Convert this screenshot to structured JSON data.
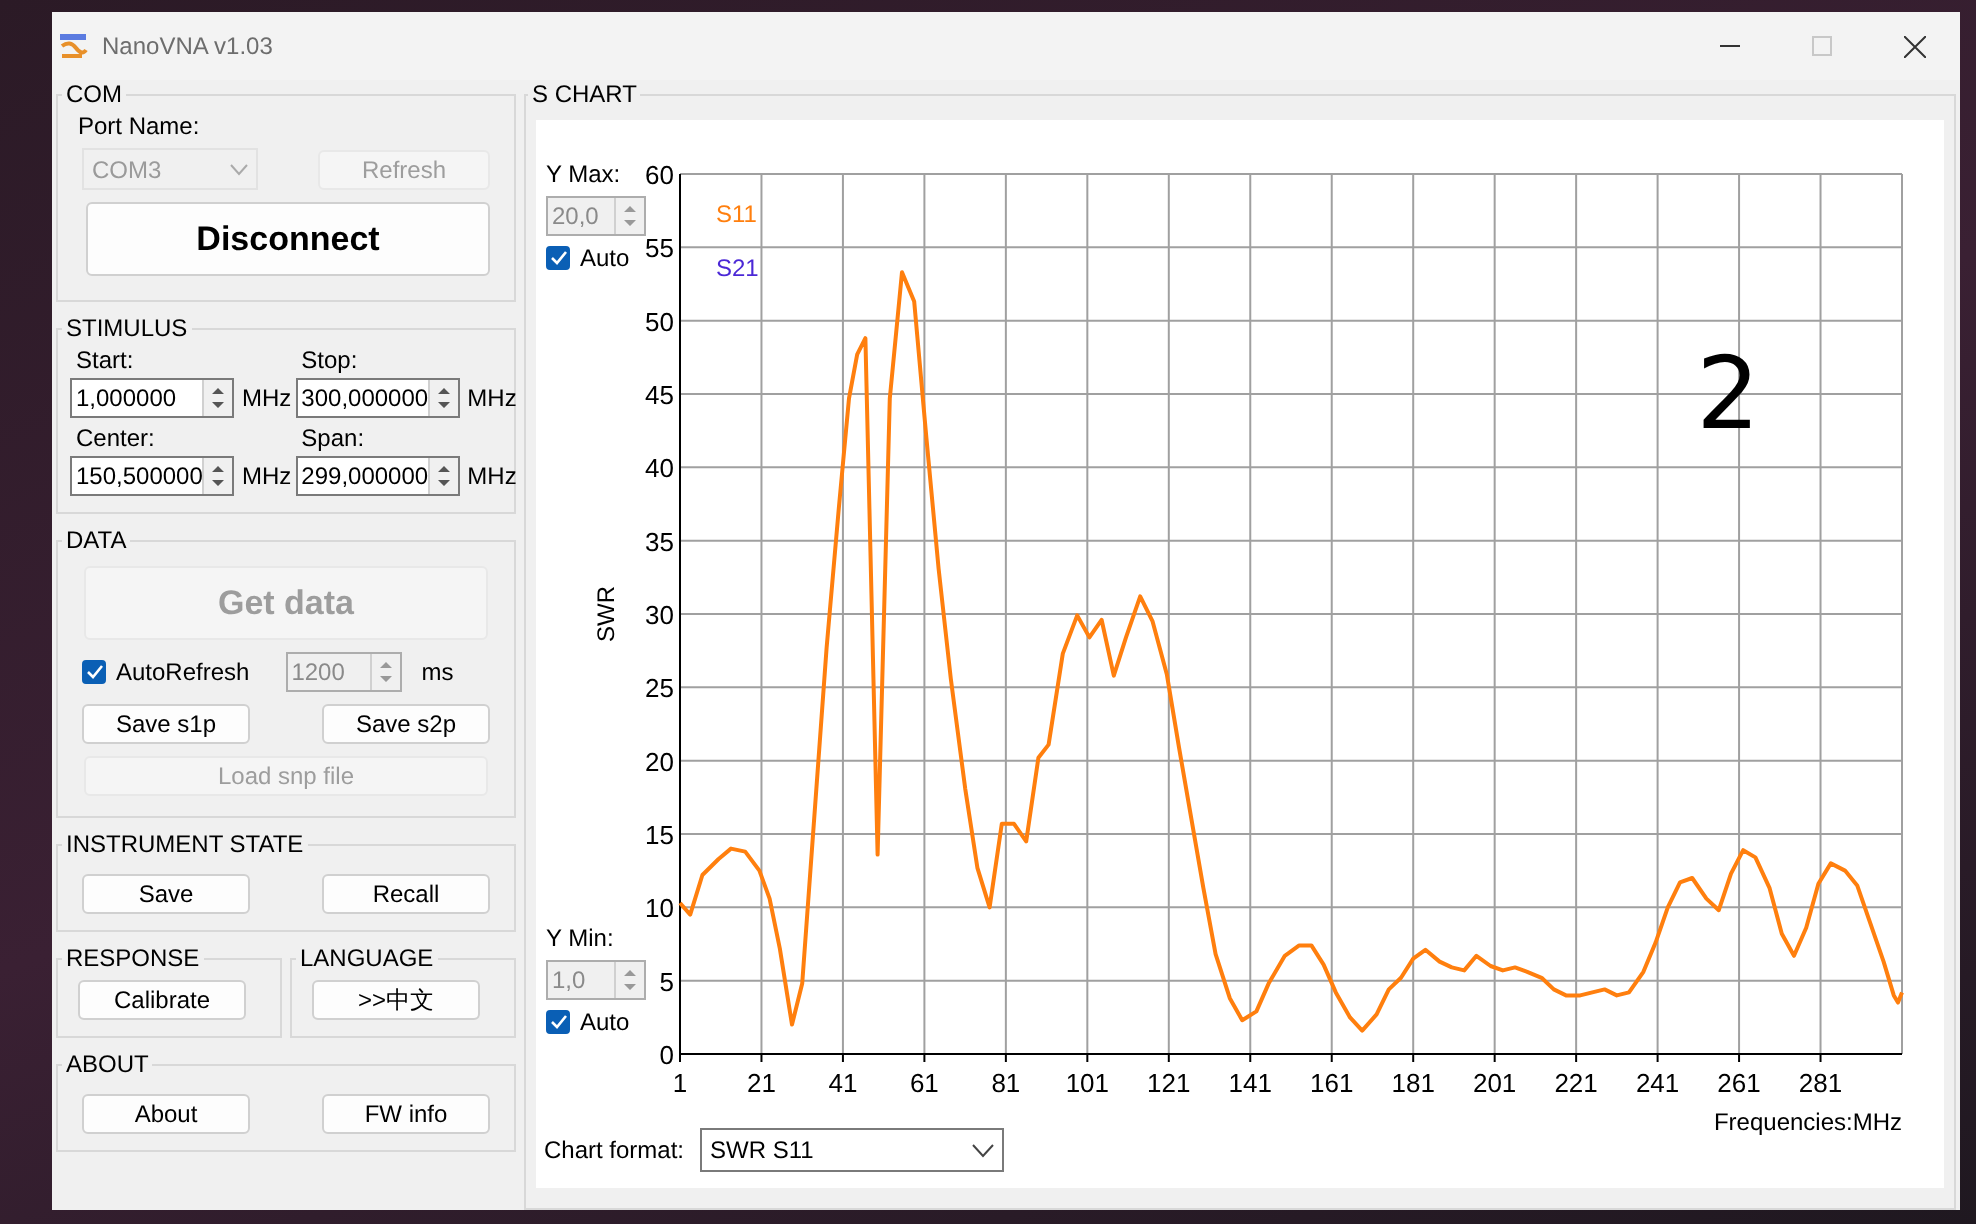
{
  "window": {
    "title": "NanoVNA v1.03",
    "maximize_disabled": true
  },
  "com": {
    "title": "COM",
    "port_label": "Port Name:",
    "port": {
      "value": "COM3",
      "disabled": true
    },
    "refresh": {
      "label": "Refresh",
      "disabled": true
    },
    "connect": {
      "label": "Disconnect"
    }
  },
  "stimulus": {
    "title": "STIMULUS",
    "fields": [
      {
        "label": "Start:",
        "value": "1,000000",
        "unit": "MHz"
      },
      {
        "label": "Stop:",
        "value": "300,000000",
        "unit": "MHz"
      },
      {
        "label": "Center:",
        "value": "150,500000",
        "unit": "MHz"
      },
      {
        "label": "Span:",
        "value": "299,000000",
        "unit": "MHz"
      }
    ]
  },
  "data": {
    "title": "DATA",
    "get_data": {
      "label": "Get data",
      "disabled": true
    },
    "auto_refresh": {
      "label": "AutoRefresh",
      "checked": true
    },
    "interval": {
      "value": "1200",
      "disabled": true
    },
    "interval_unit": "ms",
    "buttons": [
      {
        "label": "Save s1p",
        "disabled": false
      },
      {
        "label": "Save s2p",
        "disabled": false
      }
    ],
    "load": {
      "label": "Load snp file",
      "disabled": true
    }
  },
  "instrument_state": {
    "title": "INSTRUMENT STATE",
    "buttons": [
      "Save",
      "Recall"
    ]
  },
  "response": {
    "title": "RESPONSE",
    "button": "Calibrate"
  },
  "language": {
    "title": "LANGUAGE",
    "button": ">>中文"
  },
  "about": {
    "title": "ABOUT",
    "buttons": [
      "About",
      "FW info"
    ]
  },
  "chart": {
    "title": "S CHART",
    "y_max": {
      "label": "Y Max:",
      "value": "20,0",
      "disabled": true,
      "auto": {
        "label": "Auto",
        "checked": true
      }
    },
    "y_min": {
      "label": "Y Min:",
      "value": "1,0",
      "disabled": true,
      "auto": {
        "label": "Auto",
        "checked": true
      }
    },
    "extra_legend": [
      {
        "name": "S21",
        "color": "#4b28d6"
      }
    ],
    "format": {
      "label": "Chart format:",
      "value": "SWR S11"
    },
    "chart_data": {
      "type": "line",
      "xlabel": "Frequencies:MHz",
      "ylabel": "SWR",
      "xlim": [
        1,
        301
      ],
      "ylim": [
        0,
        60
      ],
      "xticks": [
        1,
        21,
        41,
        61,
        81,
        101,
        121,
        141,
        161,
        181,
        201,
        221,
        241,
        261,
        281
      ],
      "yticks": [
        0,
        5,
        10,
        15,
        20,
        25,
        30,
        35,
        40,
        45,
        50,
        55,
        60
      ],
      "annotations": [
        "2"
      ],
      "grid": true,
      "x": [
        1,
        3.5,
        6.5,
        10.5,
        13.5,
        17,
        20.5,
        23,
        25.5,
        28.5,
        31,
        37,
        40,
        42.5,
        44.5,
        46.5,
        49.5,
        52.5,
        55.5,
        58.5,
        61.5,
        64.5,
        67.5,
        71,
        74,
        77,
        80,
        83,
        86,
        89,
        91.5,
        95,
        98.5,
        101.5,
        104.5,
        107.5,
        110.5,
        114,
        117,
        120.5,
        123.5,
        126.5,
        129.5,
        132.5,
        136,
        139,
        142.5,
        145.5,
        149.5,
        153,
        156,
        159,
        162,
        165.5,
        168.5,
        172,
        175,
        178,
        181,
        184,
        187.5,
        190.5,
        193.5,
        196.5,
        200,
        203,
        206,
        209,
        212.5,
        215.5,
        218.5,
        222,
        225,
        228,
        231,
        234,
        237.5,
        240.5,
        243.5,
        246.5,
        249.5,
        253,
        256,
        259,
        262,
        265,
        268.5,
        271.5,
        274.5,
        277.5,
        280.5,
        283.5,
        287,
        290,
        293,
        296.5,
        299,
        300,
        301
      ],
      "series": [
        {
          "name": "S11",
          "color": "#ff7f0e",
          "values": [
            10.3,
            9.5,
            12.2,
            13.3,
            14.0,
            13.8,
            12.5,
            10.6,
            7.2,
            2.0,
            4.8,
            27.7,
            37.2,
            44.7,
            47.7,
            48.8,
            13.6,
            44.7,
            53.3,
            51.3,
            42,
            33.1,
            25.6,
            18.1,
            12.7,
            10,
            15.7,
            15.7,
            14.5,
            20.2,
            21.1,
            27.3,
            29.9,
            28.4,
            29.6,
            25.8,
            28.4,
            31.2,
            29.5,
            25.9,
            20.9,
            16.1,
            11.3,
            6.8,
            3.8,
            2.3,
            2.9,
            4.8,
            6.7,
            7.4,
            7.4,
            6.1,
            4.2,
            2.5,
            1.6,
            2.7,
            4.4,
            5.2,
            6.5,
            7.1,
            6.3,
            5.9,
            5.7,
            6.7,
            6.0,
            5.7,
            5.9,
            5.6,
            5.2,
            4.4,
            4.0,
            4.0,
            4.2,
            4.4,
            4.0,
            4.2,
            5.6,
            7.6,
            10,
            11.7,
            12.0,
            10.6,
            9.8,
            12.3,
            13.9,
            13.4,
            11.3,
            8.2,
            6.7,
            8.6,
            11.6,
            13.0,
            12.5,
            11.5,
            9.1,
            6.3,
            4.0,
            3.5,
            4.2
          ]
        }
      ]
    }
  }
}
